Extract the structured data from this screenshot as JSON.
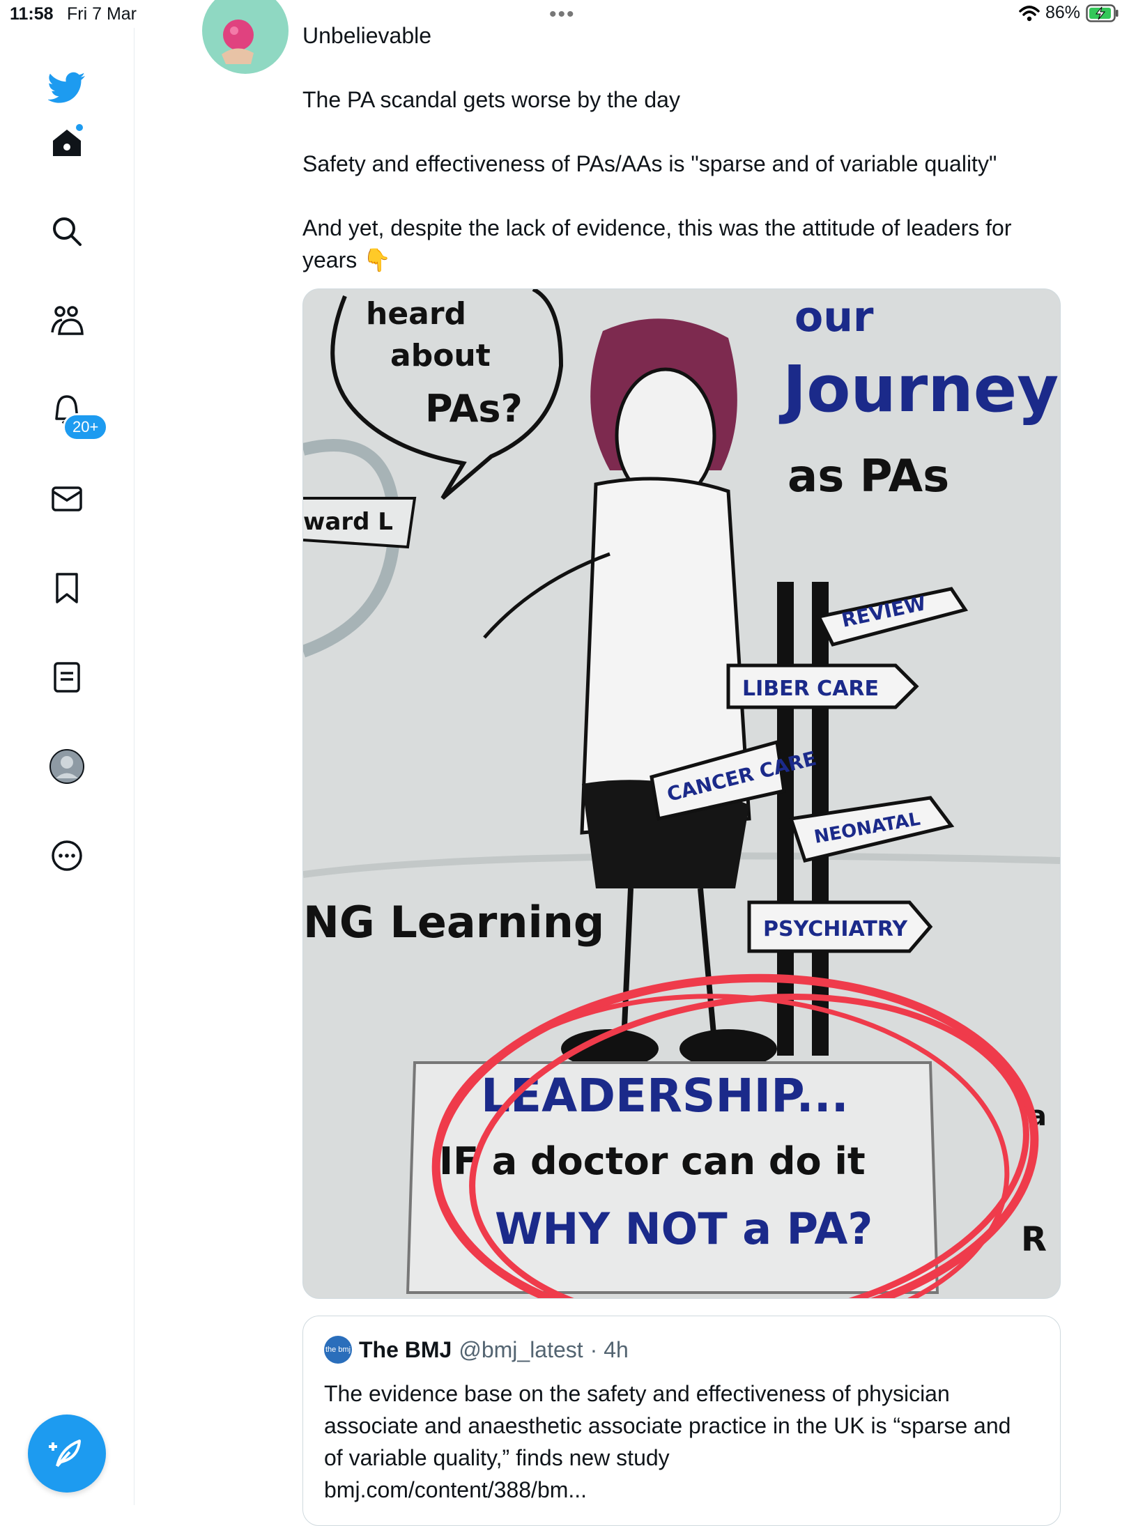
{
  "status_bar": {
    "time": "11:58",
    "date": "Fri 7 Mar",
    "battery": "86%",
    "dots": "•••"
  },
  "sidebar": {
    "items": [
      {
        "name": "home"
      },
      {
        "name": "explore"
      },
      {
        "name": "communities"
      },
      {
        "name": "notifications"
      },
      {
        "name": "messages"
      },
      {
        "name": "bookmarks"
      },
      {
        "name": "lists"
      },
      {
        "name": "profile"
      },
      {
        "name": "more"
      }
    ],
    "notifications_badge": "20+",
    "brand_color": "#1d9bf0"
  },
  "tweet": {
    "lines": [
      "Unbelievable",
      "The PA scandal gets worse by the day",
      "Safety and effectiveness of PAs/AAs is \"sparse and of variable quality\"",
      "And yet, despite the lack of evidence, this was the attitude of leaders for years 👇"
    ],
    "media": {
      "speech_bubble": [
        "heard",
        "about",
        "PAs?"
      ],
      "title": [
        "our",
        "Journey",
        "as PAs"
      ],
      "left_fragment": "ward L",
      "learning_fragment": "NG Learning",
      "signs": [
        "REVIEW",
        "LIBER CARE",
        "CANCER CARE",
        "NEONATAL",
        "PSYCHIATRY"
      ],
      "board": [
        "LEADERSHIP...",
        "IF a doctor can do it",
        "WHY NOT a PA?"
      ],
      "right_fragment": [
        "a",
        "R"
      ]
    }
  },
  "quoted_tweet": {
    "logo": "the bmj",
    "name": "The BMJ",
    "handle": "@bmj_latest",
    "time": "· 4h",
    "text": "The evidence base on the safety and effectiveness of physician associate and anaesthetic associate practice in the UK is “sparse and of variable quality,” finds new study",
    "link": "bmj.com/content/388/bm..."
  }
}
